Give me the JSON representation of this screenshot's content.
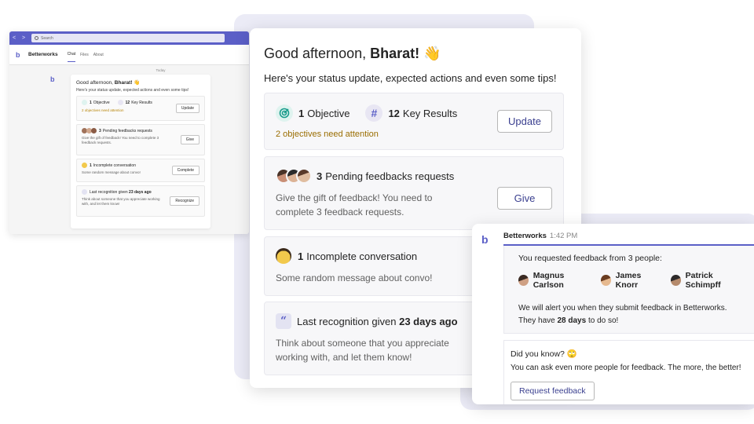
{
  "mini": {
    "nav_arrows": "< >",
    "search_placeholder": "Search",
    "app_name": "Betterworks",
    "tabs": [
      "Chat",
      "Files",
      "About"
    ],
    "day_label": "Today",
    "greeting_prefix": "Good afternoon, ",
    "greeting_name": "Bharat!",
    "greeting_emoji": "👋",
    "subtitle": "Here's your status update, expected actions and even some tips!",
    "objectives_count": "1",
    "objectives_label": "Objective",
    "key_results_count": "12",
    "key_results_label": "Key Results",
    "objectives_warning": "2 objectives need attention",
    "update_label": "Update",
    "feedback_count": "3",
    "feedback_label": "Pending feedbacks requests",
    "feedback_text": "Give the gift of feedback! You need to complete 3 feedback requests.",
    "give_label": "Give",
    "convo_count": "1",
    "convo_label": "Incomplete conversation",
    "convo_text": "Some random message about convo!",
    "complete_label": "Complete",
    "recognition_label": "Last recognition given",
    "recognition_days": "23 days ago",
    "recognition_text": "Think about someone that you appreciate working with, and let them know!",
    "recognize_label": "Recognize"
  },
  "main": {
    "greeting_prefix": "Good afternoon, ",
    "greeting_name": "Bharat!",
    "greeting_emoji": "👋",
    "subtitle": "Here's your status update, expected actions and even some tips!",
    "objectives_count": "1",
    "objectives_label": "Objective",
    "key_results_count": "12",
    "key_results_label": "Key Results",
    "objectives_warning": "2 objectives need attention",
    "update_label": "Update",
    "feedback_count": "3",
    "feedback_label": "Pending feedbacks requests",
    "feedback_text": "Give the gift of feedback! You need to complete 3 feedback requests.",
    "give_label": "Give",
    "convo_count": "1",
    "convo_label": "Incomplete conversation",
    "convo_text": "Some random message about convo!",
    "recognition_label": "Last recognition given",
    "recognition_days": "23 days ago",
    "recognition_text": "Think about someone that you appreciate working with, and let them know!",
    "hash_glyph": "#",
    "quote_glyph": "“"
  },
  "chat": {
    "sender": "Betterworks",
    "time": "1:42 PM",
    "request_text": "You requested feedback from 3 people:",
    "people": [
      "Magnus Carlson",
      "James Knorr",
      "Patrick Schimpff"
    ],
    "alert_text": "We will alert you when they submit feedback in Betterworks.",
    "deadline_prefix": "They have ",
    "deadline_days": "28 days",
    "deadline_suffix": " to do so!",
    "tip_title": "Did you know? 🙄",
    "tip_text": "You can ask even more people for feedback. The more, the better!",
    "request_button": "Request feedback"
  },
  "colors": {
    "brand": "#5b5fc7",
    "warning": "#9a6d00",
    "button_text": "#3a3f8f"
  },
  "icons": [
    "target-icon",
    "hash-icon",
    "quote-icon",
    "search-icon",
    "betterworks-logo-icon"
  ]
}
